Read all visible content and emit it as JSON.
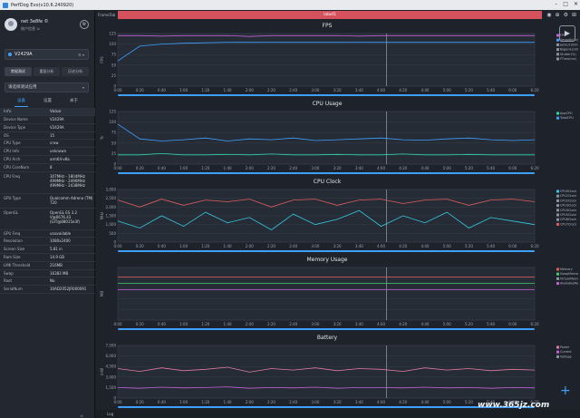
{
  "window": {
    "title": "PerfDog Evo(v10.6.240920)"
  },
  "user": {
    "name": "net 3e8fe ©",
    "sub": "账户信息 ⇲"
  },
  "device": {
    "selected": "V2429A"
  },
  "mode_tabs": [
    "常规测试",
    "重复分析",
    "历史分析"
  ],
  "app_select": {
    "placeholder": "请选择测试应用"
  },
  "info_tabs": [
    "设备",
    "设置",
    "关于"
  ],
  "info_table": {
    "headers": [
      "Info",
      "Value"
    ],
    "rows": [
      {
        "k": "Device Name",
        "v": "V2429A",
        "h": "n"
      },
      {
        "k": "Device Type",
        "v": "V2429A",
        "h": "n"
      },
      {
        "k": "OS",
        "v": "15",
        "h": "n"
      },
      {
        "k": "CPU Type",
        "v": "crow",
        "h": "n"
      },
      {
        "k": "CPU Info",
        "v": "unknown",
        "h": "n"
      },
      {
        "k": "CPU Arch",
        "v": "arm64-v8a",
        "h": "n"
      },
      {
        "k": "CPU CoreNum",
        "v": "8",
        "h": "n"
      },
      {
        "k": "CPU Freq",
        "v": "307MHz - 1804MHz\n499MHz - 2496MHz\n499MHz - 2438MHz",
        "h": "t"
      },
      {
        "k": "GPU Type",
        "v": "Qualcomm Adreno (TM) 720",
        "h": "m"
      },
      {
        "k": "OpenGL",
        "v": "OpenGL ES 3.2 V@0676.43 (GIT@88015e3f)",
        "h": "t"
      },
      {
        "k": "GPU Freq",
        "v": "unavailable",
        "h": "n"
      },
      {
        "k": "Resolution",
        "v": "1080x2400",
        "h": "n"
      },
      {
        "k": "Screen Size",
        "v": "5.81 in",
        "h": "n"
      },
      {
        "k": "Ram Size",
        "v": "14.9 GB",
        "h": "n"
      },
      {
        "k": "LMK Threshold",
        "v": "216MB",
        "h": "n"
      },
      {
        "k": "Swap",
        "v": "16383 MB",
        "h": "n"
      },
      {
        "k": "Root",
        "v": "No",
        "h": "n"
      },
      {
        "k": "SerialNum",
        "v": "10AD2052JR000091",
        "h": "n"
      }
    ]
  },
  "labelbar": {
    "frame_tab": "FrameTab",
    "label": "label1"
  },
  "bottom": {
    "log": "Log"
  },
  "watermark": "www.365jz.com",
  "colors": {
    "accent": "#3fa0ff",
    "label": "#d5525c",
    "fps": "#c15fd6",
    "teal": "#2fd3b0",
    "green": "#3fd06a",
    "red": "#e05d5d",
    "pink": "#e07aa0",
    "cyan": "#36c8e0"
  },
  "time_ticks": [
    "0:00",
    "0:20",
    "0:40",
    "1:00",
    "1:20",
    "1:40",
    "2:00",
    "2:20",
    "2:40",
    "3:00",
    "3:20",
    "3:40",
    "4:00",
    "4:20",
    "4:40",
    "5:00",
    "5:20",
    "5:40",
    "6:00",
    "6:20"
  ],
  "chart_data": [
    {
      "type": "line",
      "title": "FPS",
      "ylabel": "FPS",
      "ylim": [
        0,
        125
      ],
      "yticks": [
        "0",
        "25",
        "50",
        "75",
        "100",
        "125"
      ],
      "legend": [
        "FPS",
        "Smooth(Hz)",
        "Jank(/10min)",
        "BigJank(/10min)",
        "Stutter(%)",
        "FTime(ms)"
      ],
      "series": [
        {
          "name": "FPS",
          "color": "#c15fd6",
          "values": [
            120,
            120,
            119,
            120,
            120,
            120,
            118,
            120,
            120,
            120,
            120,
            119,
            120,
            120,
            120,
            120,
            120,
            120,
            120,
            120
          ]
        },
        {
          "name": "Smooth(Hz)",
          "color": "#3fa0ff",
          "values": [
            60,
            95,
            100,
            102,
            103,
            104,
            104,
            104,
            104,
            104,
            104,
            104,
            104,
            104,
            104,
            104,
            104,
            104,
            104,
            104
          ]
        }
      ]
    },
    {
      "type": "line",
      "title": "CPU Usage",
      "ylabel": "%",
      "ylim": [
        0,
        125
      ],
      "yticks": [
        "0",
        "25",
        "50",
        "75",
        "100",
        "125"
      ],
      "legend": [
        "AppCPU",
        "TotalCPU"
      ],
      "series": [
        {
          "name": "AppCPU",
          "color": "#2fd3b0",
          "values": [
            22,
            22,
            25,
            22,
            22,
            23,
            22,
            24,
            22,
            22,
            23,
            22,
            22,
            24,
            22,
            22,
            23,
            22,
            22,
            22
          ]
        },
        {
          "name": "TotalCPU",
          "color": "#3fa0ff",
          "values": [
            95,
            60,
            55,
            58,
            62,
            55,
            60,
            58,
            62,
            56,
            58,
            60,
            62,
            58,
            57,
            60,
            62,
            58,
            56,
            58
          ]
        }
      ]
    },
    {
      "type": "line",
      "title": "CPU Clock",
      "ylabel": "MHz",
      "ylim": [
        0,
        3000
      ],
      "yticks": [
        "0",
        "500",
        "1,000",
        "1,500",
        "2,000",
        "2,500",
        "3,000"
      ],
      "legend": [
        "CPU0Clock",
        "CPU1Clock",
        "CPU2Clock",
        "CPU3Clock",
        "CPU4Clock",
        "CPU5Clock",
        "CPU6Clock",
        "CPU7Clock"
      ],
      "series": [
        {
          "name": "CPU0Clock",
          "color": "#36c8e0",
          "values": [
            1200,
            800,
            1500,
            900,
            1700,
            1100,
            1400,
            700,
            1600,
            1000,
            1300,
            1800,
            900,
            1500,
            1100,
            1700,
            800,
            1400,
            1200,
            1000
          ]
        },
        {
          "name": "CPU7Clock",
          "color": "#e05d5d",
          "values": [
            2400,
            2000,
            2450,
            2100,
            2400,
            2300,
            2450,
            2000,
            2400,
            2450,
            2100,
            2400,
            2450,
            2200,
            2400,
            2450,
            2100,
            2400,
            2450,
            2300
          ]
        }
      ]
    },
    {
      "type": "line",
      "title": "Memory Usage",
      "ylabel": "MB",
      "ylim": [
        0,
        1
      ],
      "yticks": [],
      "legend": [
        "Memory",
        "SwapMemory",
        "VirtualMemory",
        "AvailableMemory"
      ],
      "series": [
        {
          "name": "Memory",
          "color": "#e05d5d",
          "values": [
            0.82,
            0.82,
            0.82,
            0.82,
            0.82,
            0.82,
            0.82,
            0.82,
            0.82,
            0.82,
            0.82,
            0.82,
            0.82,
            0.82,
            0.82,
            0.82,
            0.82,
            0.82,
            0.82,
            0.82
          ]
        },
        {
          "name": "SwapMemory",
          "color": "#3fd06a",
          "values": [
            0.7,
            0.7,
            0.7,
            0.7,
            0.7,
            0.7,
            0.7,
            0.7,
            0.7,
            0.7,
            0.7,
            0.7,
            0.7,
            0.7,
            0.7,
            0.7,
            0.7,
            0.7,
            0.7,
            0.7
          ]
        },
        {
          "name": "AvailableMemory",
          "color": "#c15fd6",
          "values": [
            0.58,
            0.58,
            0.58,
            0.58,
            0.58,
            0.58,
            0.58,
            0.58,
            0.58,
            0.58,
            0.58,
            0.58,
            0.58,
            0.58,
            0.58,
            0.58,
            0.58,
            0.58,
            0.58,
            0.58
          ]
        }
      ]
    },
    {
      "type": "line",
      "title": "Battery",
      "ylabel": "mW",
      "ylim": [
        0,
        7500
      ],
      "yticks": [
        "0",
        "1,500",
        "3,000",
        "4,500",
        "6,000",
        "7,500"
      ],
      "legend": [
        "Power",
        "Current",
        "Voltage"
      ],
      "series": [
        {
          "name": "Power",
          "color": "#e07aa0",
          "values": [
            4200,
            3800,
            4300,
            3900,
            4100,
            4400,
            3700,
            4200,
            4000,
            4300,
            3900,
            4200,
            4100,
            3800,
            4300,
            4000,
            4200,
            3900,
            4100,
            4000
          ]
        },
        {
          "name": "Current",
          "color": "#c15fd6",
          "values": [
            1500,
            1400,
            1550,
            1450,
            1500,
            1600,
            1400,
            1500,
            1450,
            1550,
            1400,
            1500,
            1500,
            1450,
            1550,
            1450,
            1500,
            1400,
            1500,
            1450
          ]
        }
      ]
    }
  ]
}
